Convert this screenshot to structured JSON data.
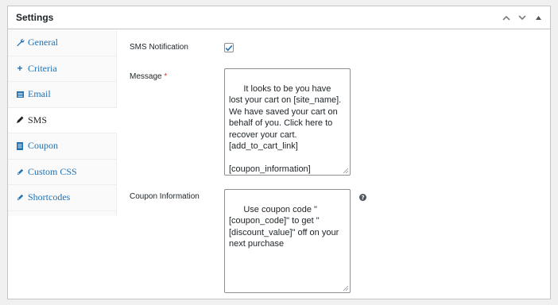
{
  "panel": {
    "title": "Settings"
  },
  "tabs": [
    {
      "label": "General",
      "icon": "wrench-icon",
      "glyph": "🔧"
    },
    {
      "label": "Criteria",
      "icon": "plus-icon",
      "glyph": "+"
    },
    {
      "label": "Email",
      "icon": "list-icon",
      "glyph": "▤"
    },
    {
      "label": "SMS",
      "icon": "pen-icon",
      "glyph": "✎"
    },
    {
      "label": "Coupon",
      "icon": "document-icon",
      "glyph": "▤"
    },
    {
      "label": "Custom CSS",
      "icon": "edit-icon",
      "glyph": "✐"
    },
    {
      "label": "Shortcodes",
      "icon": "edit-icon",
      "glyph": "✐"
    }
  ],
  "active_tab": "SMS",
  "form": {
    "sms_notification": {
      "label": "SMS Notification",
      "checked": true
    },
    "message": {
      "label": "Message",
      "required_mark": "*",
      "value": "It looks to be you have lost your cart on [site_name]. We have saved your cart on behalf of you. Click here to recover your cart.\n[add_to_cart_link]\n\n[coupon_information]"
    },
    "coupon_information": {
      "label": "Coupon Information",
      "value": "Use coupon code \"[coupon_code]\" to get \"[discount_value]\" off on your next purchase",
      "help_glyph": "?"
    }
  },
  "colors": {
    "link": "#2271b1",
    "required": "#d63638",
    "border": "#c3c4c7"
  }
}
